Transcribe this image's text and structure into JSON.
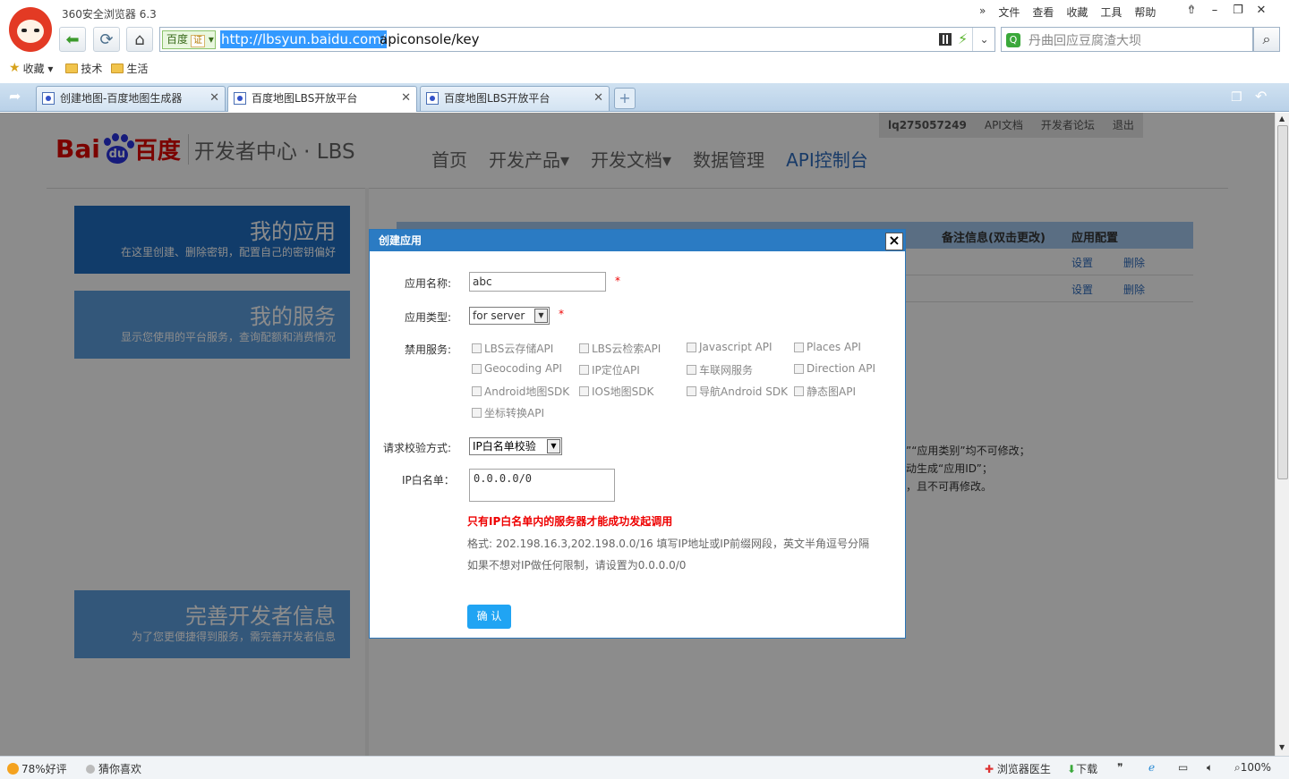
{
  "browser": {
    "title": "360安全浏览器 6.3",
    "menu": [
      "文件",
      "查看",
      "收藏",
      "工具",
      "帮助"
    ],
    "url_badge": "百度",
    "url_badge_tag": "证",
    "url_host": "http://lbsyun.baidu.com/",
    "url_path": "apiconsole/key",
    "search_placeholder": "丹曲回应豆腐渣大坝",
    "favorites": {
      "label": "收藏",
      "folders": [
        "技术",
        "生活"
      ]
    },
    "tabs": [
      {
        "label": "创建地图-百度地图生成器",
        "active": false
      },
      {
        "label": "百度地图LBS开放平台",
        "active": true
      },
      {
        "label": "百度地图LBS开放平台",
        "active": false
      }
    ]
  },
  "site": {
    "user": {
      "name": "lq275057249",
      "links": [
        "API文档",
        "开发者论坛",
        "退出"
      ]
    },
    "logo": {
      "bai": "Bai",
      "du_pad": "du",
      "du": "百度",
      "sub": "开发者中心 · LBS"
    },
    "nav": [
      {
        "label": "首页",
        "selected": false
      },
      {
        "label": "开发产品▾",
        "selected": false
      },
      {
        "label": "开发文档▾",
        "selected": false
      },
      {
        "label": "数据管理",
        "selected": false
      },
      {
        "label": "API控制台",
        "selected": true
      }
    ],
    "side_cards": [
      {
        "title": "我的应用",
        "subtitle": "在这里创建、删除密钥，配置自己的密钥偏好"
      },
      {
        "title": "我的服务",
        "subtitle": "显示您使用的平台服务，查询配额和消费情况"
      },
      {
        "title": "完善开发者信息",
        "subtitle": "为了您更便捷得到服务，需完善开发者信息"
      }
    ],
    "table": {
      "headers": [
        "备注信息(双击更改)",
        "应用配置"
      ],
      "rows": [
        {
          "set": "设置",
          "del": "删除"
        },
        {
          "set": "设置",
          "del": "删除"
        }
      ]
    },
    "notes": [
      "”“应用类别”均不可修改；",
      "动生成“应用ID”；",
      "，且不可再修改。"
    ]
  },
  "dialog": {
    "title": "创建应用",
    "close": "×",
    "name_label": "应用名称:",
    "name_value": "abc",
    "type_label": "应用类型:",
    "type_value": "for server",
    "required_mark": "*",
    "services_label": "禁用服务:",
    "services": [
      "LBS云存储API",
      "LBS云检索API",
      "Javascript API",
      "Places API",
      "Geocoding API",
      "IP定位API",
      "车联网服务",
      "Direction API",
      "Android地图SDK",
      "IOS地图SDK",
      "导航Android SDK",
      "静态图API",
      "坐标转换API"
    ],
    "verify_label": "请求校验方式:",
    "verify_value": "IP白名单校验",
    "ip_label": "IP白名单：",
    "ip_value": "0.0.0.0/0",
    "warning": "只有IP白名单内的服务器才能成功发起调用",
    "hint1": "格式: 202.198.16.3,202.198.0.0/16 填写IP地址或IP前缀网段，英文半角逗号分隔",
    "hint2": "如果不想对IP做任何限制，请设置为0.0.0.0/0",
    "ok": "确 认"
  },
  "statusbar": {
    "rating": "78%好评",
    "guess": "猜你喜欢",
    "doctor": "浏览器医生",
    "download": "下载",
    "zoom": "100%"
  }
}
